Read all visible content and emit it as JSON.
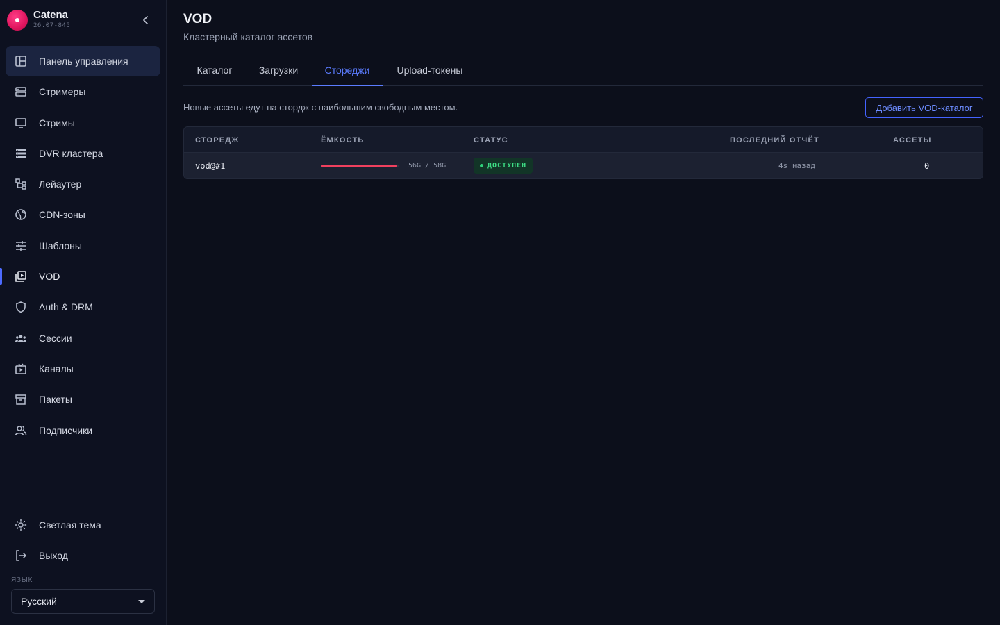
{
  "app": {
    "name": "Catena",
    "version": "26.07-845"
  },
  "sidebar": {
    "items": [
      {
        "label": "Панель управления",
        "icon": "dashboard-icon"
      },
      {
        "label": "Стримеры",
        "icon": "server-icon"
      },
      {
        "label": "Стримы",
        "icon": "monitor-icon"
      },
      {
        "label": "DVR кластера",
        "icon": "storage-icon"
      },
      {
        "label": "Лейаутер",
        "icon": "layout-icon"
      },
      {
        "label": "CDN-зоны",
        "icon": "globe-icon"
      },
      {
        "label": "Шаблоны",
        "icon": "sliders-icon"
      },
      {
        "label": "VOD",
        "icon": "video-library-icon"
      },
      {
        "label": "Auth & DRM",
        "icon": "shield-icon"
      },
      {
        "label": "Сессии",
        "icon": "users-icon"
      },
      {
        "label": "Каналы",
        "icon": "tv-icon"
      },
      {
        "label": "Пакеты",
        "icon": "archive-icon"
      },
      {
        "label": "Подписчики",
        "icon": "subscribers-icon"
      }
    ],
    "bottom": [
      {
        "label": "Светлая тема",
        "icon": "sun-icon"
      },
      {
        "label": "Выход",
        "icon": "logout-icon"
      }
    ],
    "language_label": "ЯЗЫК",
    "language_value": "Русский"
  },
  "page": {
    "title": "VOD",
    "subtitle": "Кластерный каталог ассетов",
    "tabs": [
      "Каталог",
      "Загрузки",
      "Стореджи",
      "Upload-токены"
    ],
    "active_tab": "Стореджи",
    "hint": "Новые ассеты едут на стордж с наибольшим свободным местом.",
    "add_button": "Добавить VOD-каталог"
  },
  "storage_table": {
    "columns": [
      "СТОРЕДЖ",
      "ЁМКОСТЬ",
      "СТАТУС",
      "ПОСЛЕДНИЙ ОТЧЁТ",
      "АССЕТЫ"
    ],
    "rows": [
      {
        "storage": "vod@#1",
        "capacity": "56G / 58G",
        "capacity_fraction": 0.966,
        "status": "ДОСТУПЕН",
        "last_report": "4s назад",
        "assets": "0"
      }
    ]
  },
  "colors": {
    "accent": "#5b7cff",
    "danger": "#f0405e",
    "success": "#3ddc84"
  }
}
